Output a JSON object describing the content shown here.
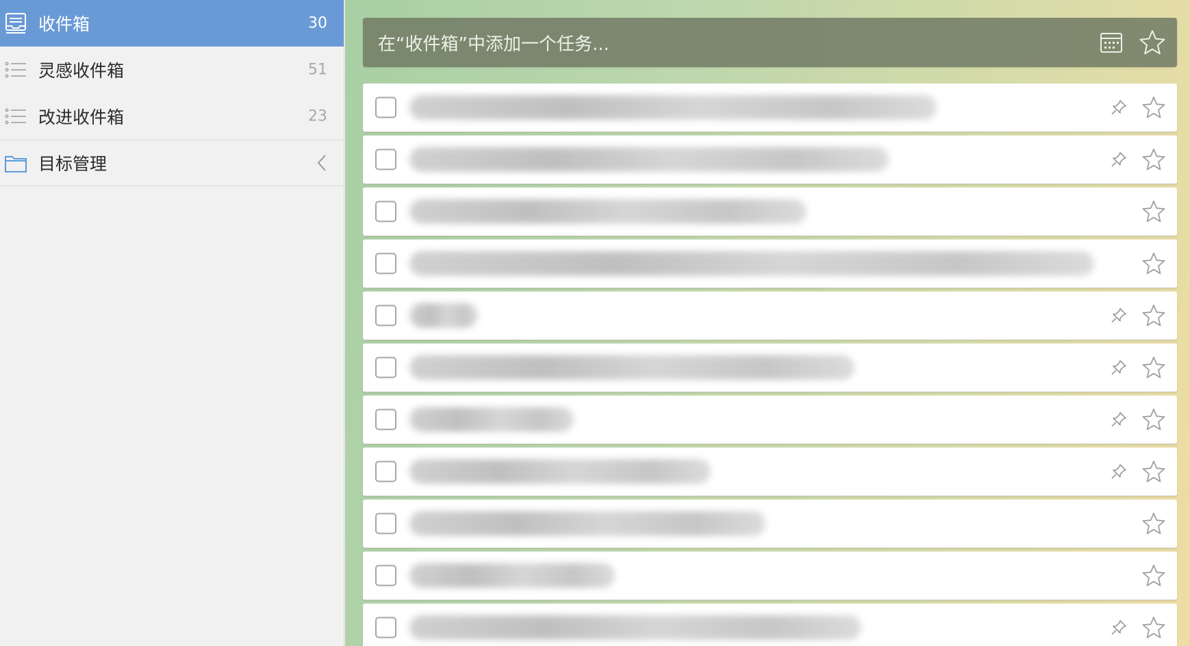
{
  "sidebar": {
    "items": [
      {
        "label": "收件箱",
        "count": "30",
        "icon": "inbox-icon",
        "active": true
      },
      {
        "label": "灵感收件箱",
        "count": "51",
        "icon": "list-icon",
        "active": false
      },
      {
        "label": "改进收件箱",
        "count": "23",
        "icon": "list-icon",
        "active": false
      }
    ],
    "folder": {
      "label": "目标管理",
      "icon": "folder-icon"
    }
  },
  "add_bar": {
    "placeholder": "在“收件箱”中添加一个任务...",
    "calendar_icon": "calendar-icon",
    "star_icon": "star-outline-icon"
  },
  "tasks": [
    {
      "has_pin": true,
      "starred": false
    },
    {
      "has_pin": true,
      "starred": false
    },
    {
      "has_pin": false,
      "starred": false
    },
    {
      "has_pin": false,
      "starred": false
    },
    {
      "has_pin": true,
      "starred": false
    },
    {
      "has_pin": true,
      "starred": false
    },
    {
      "has_pin": true,
      "starred": false
    },
    {
      "has_pin": true,
      "starred": false
    },
    {
      "has_pin": false,
      "starred": false
    },
    {
      "has_pin": false,
      "starred": false
    },
    {
      "has_pin": true,
      "starred": false
    }
  ],
  "colors": {
    "sidebar_active": "#6a9ad6",
    "add_bar_bg": "#737d66",
    "checkbox_border": "#a6a6a6",
    "icon_gray": "#9a9a9a"
  }
}
